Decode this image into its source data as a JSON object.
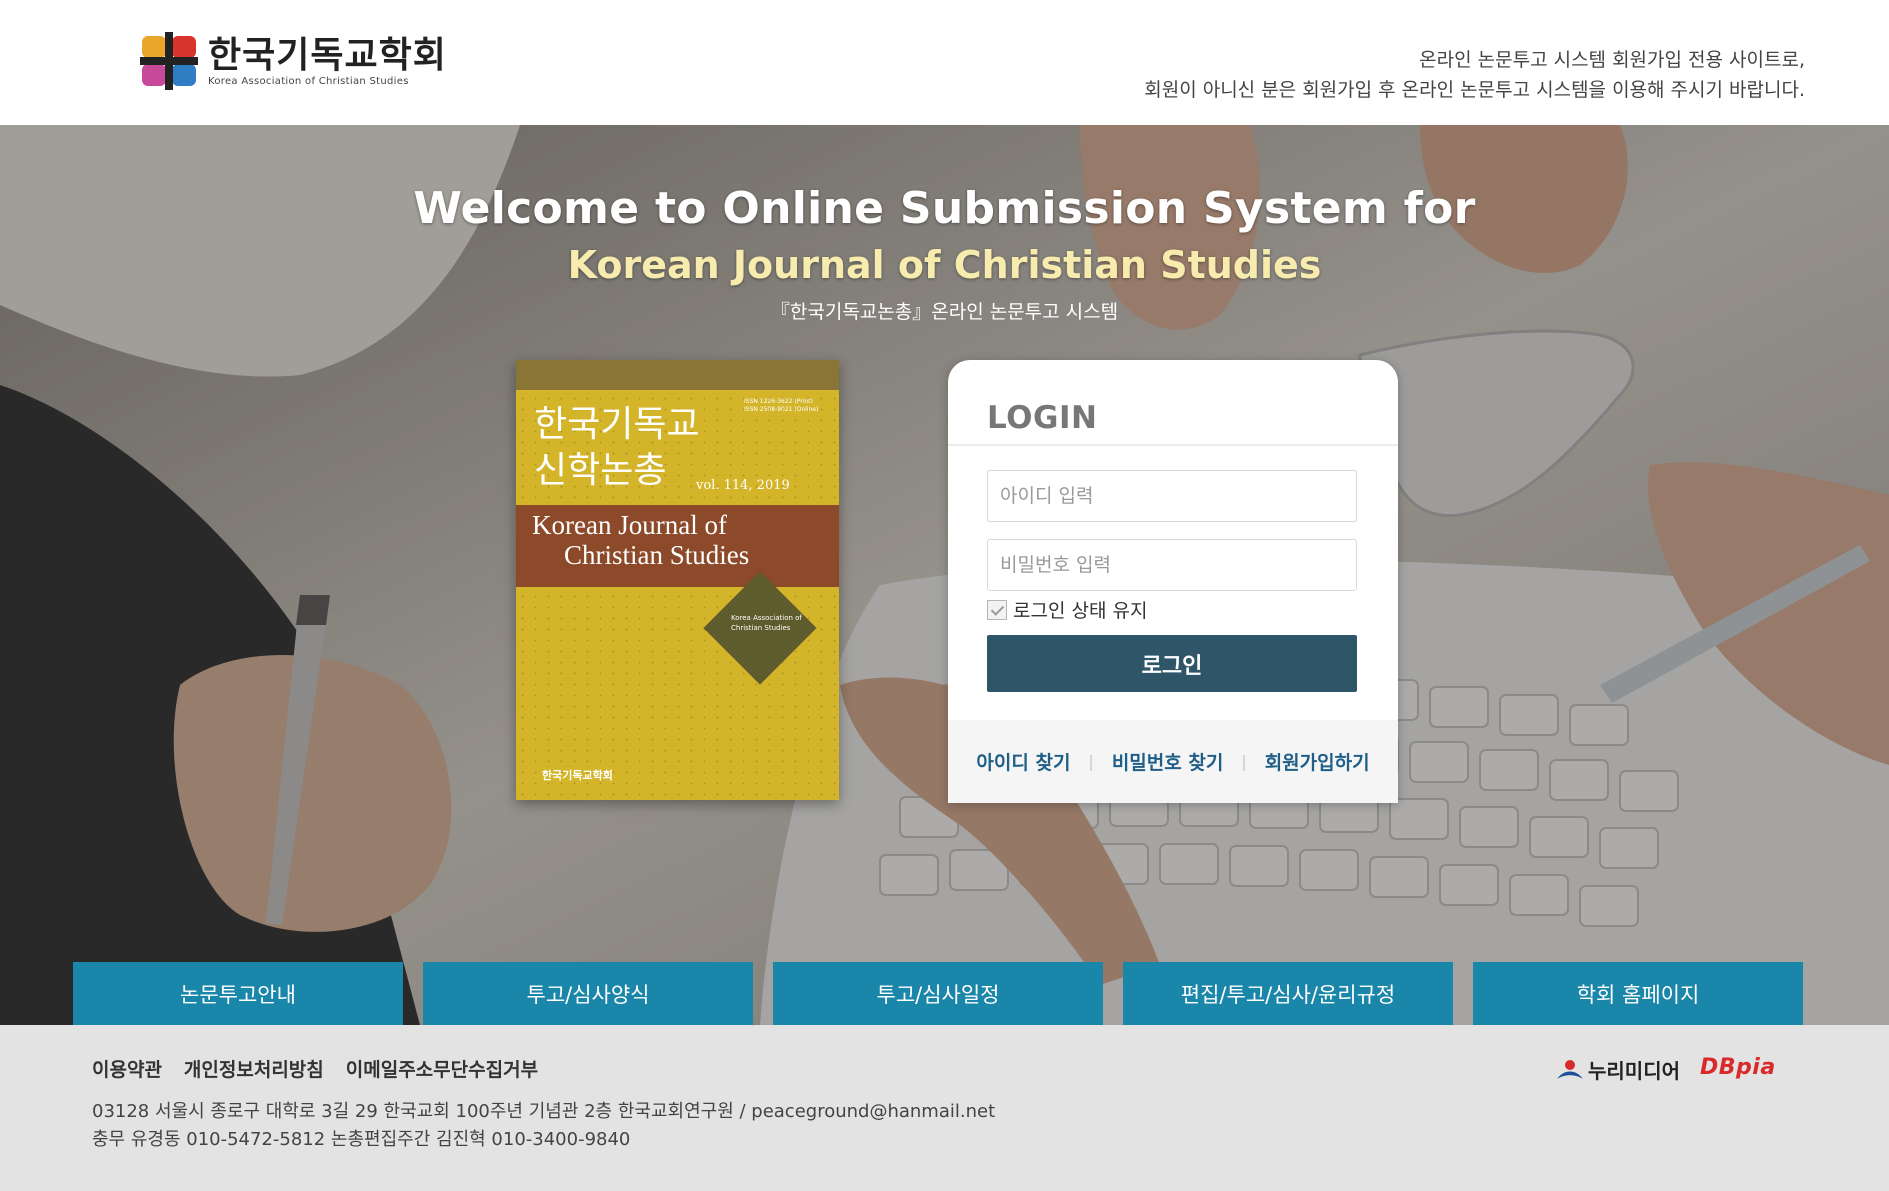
{
  "header": {
    "logo": {
      "name": "한국기독교학회",
      "subtitle": "Korea Association of Christian Studies"
    },
    "notice_line1": "온라인 논문투고 시스템 회원가입 전용 사이트로,",
    "notice_line2": "회원이 아니신 분은 회원가입 후 온라인 논문투고 시스템을 이용해 주시기 바랍니다."
  },
  "hero": {
    "title": "Welcome to Online Submission System for",
    "subtitle": "Korean Journal of Christian Studies",
    "caption": "『한국기독교논총』온라인 논문투고 시스템"
  },
  "cover": {
    "issn_print": "ISSN 1226-3622 (Print)",
    "issn_online": "ISSN 2508-9021 (Online)",
    "title_ko_line1": "한국기독교",
    "title_ko_line2": "신학논총",
    "volume": "vol. 114, 2019",
    "title_en_line1": "Korean Journal of",
    "title_en_line2": "Christian Studies",
    "diamond_line1": "Korea Association of",
    "diamond_line2": "Christian Studies",
    "publisher": "한국기독교학회"
  },
  "login": {
    "title": "LOGIN",
    "id_placeholder": "아이디 입력",
    "pw_placeholder": "비밀번호 입력",
    "keep_label": "로그인 상태 유지",
    "submit_label": "로그인",
    "find_id": "아이디 찾기",
    "find_pw": "비밀번호 찾기",
    "signup": "회원가입하기"
  },
  "nav": [
    {
      "label": "논문투고안내"
    },
    {
      "label": "투고/심사양식"
    },
    {
      "label": "투고/심사일정"
    },
    {
      "label": "편집/투고/심사/윤리규정"
    },
    {
      "label": "학회 홈페이지"
    }
  ],
  "footer": {
    "links": [
      "이용약관",
      "개인정보처리방침",
      "이메일주소무단수집거부"
    ],
    "address_line1": "03128 서울시 종로구 대학로 3길 29 한국교회 100주년 기념관 2층 한국교회연구원 / peaceground@hanmail.net",
    "address_line2": "충무 유경동 010-5472-5812 논총편집주간 김진혁 010-3400-9840",
    "partner_nuri": "누리미디어",
    "partner_dbpia": "DBpia"
  },
  "colors": {
    "login_button": "#2e5568",
    "nav_button": "#1a86aa",
    "hero_subtitle": "#f7ecae",
    "link": "#1f5e86",
    "dbpia": "#d82a2a",
    "cover_yellow": "#d4b52a",
    "cover_band": "#8c4a2a"
  },
  "icons": {
    "logo_mark": "cross-color-blocks-icon",
    "checkbox": "checkmark-icon",
    "nuri_mark": "nurimedia-swoosh-icon"
  }
}
